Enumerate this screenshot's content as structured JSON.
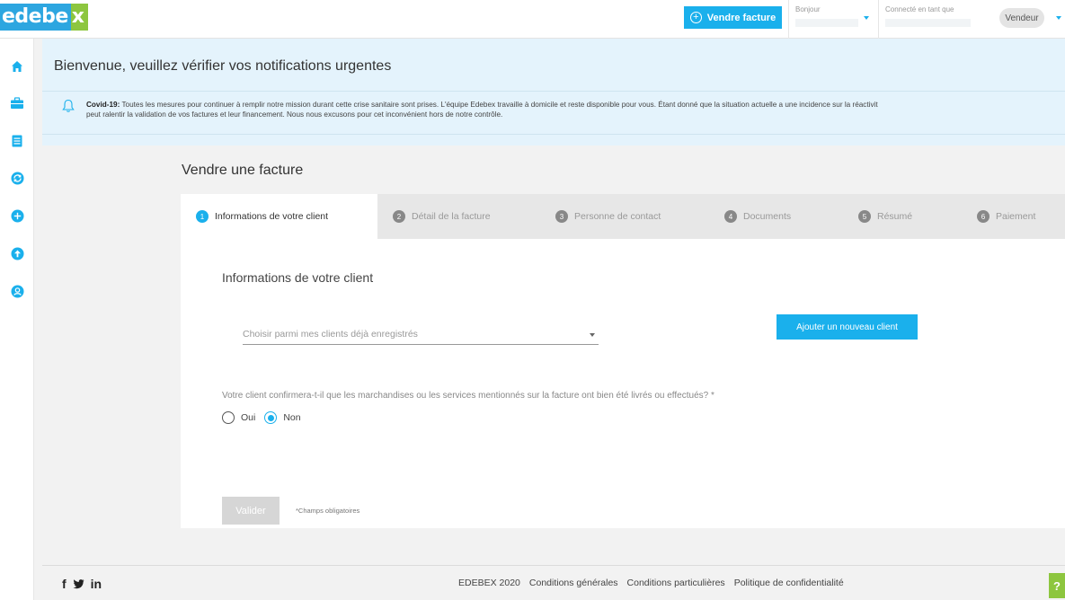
{
  "header": {
    "logo_part1": "edebe",
    "logo_part2": "x",
    "sell_button": "Vendre facture",
    "hello_label": "Bonjour",
    "connected_label": "Connecté en tant que",
    "role": "Vendeur"
  },
  "sidebar": {
    "items": [
      {
        "icon": "home-icon"
      },
      {
        "icon": "briefcase-icon"
      },
      {
        "icon": "list-icon"
      },
      {
        "icon": "refresh-icon"
      },
      {
        "icon": "add-circle-icon"
      },
      {
        "icon": "upload-icon"
      },
      {
        "icon": "support-icon"
      }
    ]
  },
  "notice": {
    "welcome": "Bienvenue, veuillez vérifier vos notifications urgentes",
    "title": "Covid-19:",
    "line1": " Toutes les mesures pour continuer à remplir notre mission durant cette crise sanitaire sont prises. L'équipe Edebex travaille à domicile et reste disponible pour vous. Étant donné que la situation actuelle a une incidence sur la réactivit",
    "line2": "peut ralentir la validation de vos factures et leur financement. Nous nous excusons pour cet inconvénient hors de notre contrôle."
  },
  "page": {
    "title": "Vendre une facture"
  },
  "tabs": [
    {
      "num": "1",
      "label": "Informations de votre client"
    },
    {
      "num": "2",
      "label": "Détail de la facture"
    },
    {
      "num": "3",
      "label": "Personne de contact"
    },
    {
      "num": "4",
      "label": "Documents"
    },
    {
      "num": "5",
      "label": "Résumé"
    },
    {
      "num": "6",
      "label": "Paiement"
    }
  ],
  "form": {
    "title": "Informations de votre client",
    "client_select_placeholder": "Choisir parmi mes clients déjà enregistrés",
    "add_client_button": "Ajouter un nouveau client",
    "question": "Votre client confirmera-t-il que les marchandises ou les services mentionnés sur la facture ont bien été livrés ou effectués? *",
    "option_yes": "Oui",
    "option_no": "Non",
    "selected_option": "Non",
    "validate_button": "Valider",
    "required_note": "*Champs obligatoires"
  },
  "footer": {
    "copyright": "EDEBEX 2020",
    "link_terms": "Conditions générales",
    "link_special": "Conditions particulières",
    "link_privacy": "Politique de confidentialité",
    "help": "?"
  },
  "colors": {
    "accent": "#1ab0ec",
    "brand_green": "#8dc63f",
    "notice_bg": "#e4f3fc"
  }
}
